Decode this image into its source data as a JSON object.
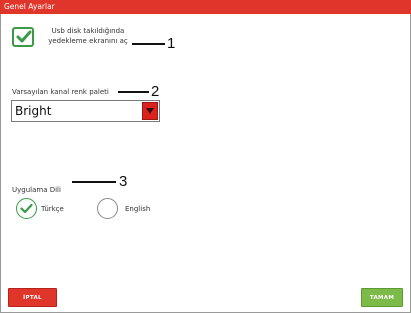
{
  "window": {
    "title": "Genel Ayarlar"
  },
  "backup_option": {
    "label": "Usb disk takıldığında yedekleme ekranını aç",
    "checked": true
  },
  "palette": {
    "label": "Varsayılan kanal renk paleti",
    "selected_value": "Bright"
  },
  "language": {
    "label": "Uygulama Dili",
    "options": [
      {
        "label": "Türkçe",
        "selected": true
      },
      {
        "label": "English",
        "selected": false
      }
    ]
  },
  "callouts": [
    "1",
    "2",
    "3"
  ],
  "footer": {
    "cancel_label": "İPTAL",
    "ok_label": "TAMAM"
  },
  "colors": {
    "title_bar": "#e0352a",
    "check": "#3a9a46",
    "select_button": "#d9231c",
    "ok_button": "#7dbb48"
  },
  "icons": {
    "checkbox": "checkmark-icon",
    "radio": "checkmark-icon",
    "select": "triangle-down-icon"
  }
}
